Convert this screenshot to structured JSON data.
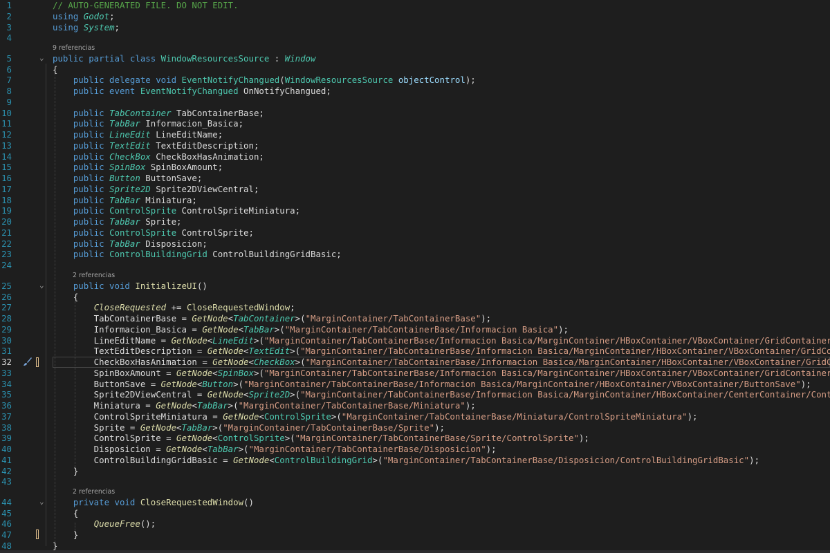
{
  "editor": {
    "current_line": 32,
    "lines": [
      {
        "n": 1,
        "t": [
          [
            "cm",
            "// AUTO-GENERATED FILE. DO NOT EDIT."
          ]
        ]
      },
      {
        "n": 2,
        "t": [
          [
            "kw",
            "using "
          ],
          [
            "ty",
            "Godot"
          ],
          [
            "ev",
            ";"
          ]
        ]
      },
      {
        "n": 3,
        "t": [
          [
            "kw",
            "using "
          ],
          [
            "ty",
            "System"
          ],
          [
            "ev",
            ";"
          ]
        ]
      },
      {
        "n": 4,
        "t": []
      },
      {
        "n": 5,
        "lens": "9 referencias",
        "t": [
          [
            "kw",
            "public partial class "
          ],
          [
            "cl",
            "WindowResourcesSource"
          ],
          [
            "ev",
            " : "
          ],
          [
            "ty",
            "Window"
          ]
        ]
      },
      {
        "n": 6,
        "t": [
          [
            "ev",
            "{"
          ]
        ]
      },
      {
        "n": 7,
        "t": [
          [
            "kw",
            "    public delegate void "
          ],
          [
            "cl",
            "EventNotifyChangued"
          ],
          [
            "ev",
            "("
          ],
          [
            "cl",
            "WindowResourcesSource"
          ],
          [
            "ev",
            " "
          ],
          [
            "prm",
            "objectControl"
          ],
          [
            "ev",
            ");"
          ]
        ]
      },
      {
        "n": 8,
        "t": [
          [
            "kw",
            "    public event "
          ],
          [
            "cl",
            "EventNotifyChangued"
          ],
          [
            "ev",
            " OnNotifyChangued;"
          ]
        ]
      },
      {
        "n": 9,
        "t": []
      },
      {
        "n": 10,
        "t": [
          [
            "kw",
            "    public "
          ],
          [
            "ty",
            "TabContainer"
          ],
          [
            "ev",
            " TabContainerBase;"
          ]
        ]
      },
      {
        "n": 11,
        "t": [
          [
            "kw",
            "    public "
          ],
          [
            "ty",
            "TabBar"
          ],
          [
            "ev",
            " Informacion_Basica;"
          ]
        ]
      },
      {
        "n": 12,
        "t": [
          [
            "kw",
            "    public "
          ],
          [
            "ty",
            "LineEdit"
          ],
          [
            "ev",
            " LineEditName;"
          ]
        ]
      },
      {
        "n": 13,
        "t": [
          [
            "kw",
            "    public "
          ],
          [
            "ty",
            "TextEdit"
          ],
          [
            "ev",
            " TextEditDescription;"
          ]
        ]
      },
      {
        "n": 14,
        "t": [
          [
            "kw",
            "    public "
          ],
          [
            "ty",
            "CheckBox"
          ],
          [
            "ev",
            " CheckBoxHasAnimation;"
          ]
        ]
      },
      {
        "n": 15,
        "t": [
          [
            "kw",
            "    public "
          ],
          [
            "ty",
            "SpinBox"
          ],
          [
            "ev",
            " SpinBoxAmount;"
          ]
        ]
      },
      {
        "n": 16,
        "t": [
          [
            "kw",
            "    public "
          ],
          [
            "ty",
            "Button"
          ],
          [
            "ev",
            " ButtonSave;"
          ]
        ]
      },
      {
        "n": 17,
        "t": [
          [
            "kw",
            "    public "
          ],
          [
            "ty",
            "Sprite2D"
          ],
          [
            "ev",
            " Sprite2DViewCentral;"
          ]
        ]
      },
      {
        "n": 18,
        "t": [
          [
            "kw",
            "    public "
          ],
          [
            "ty",
            "TabBar"
          ],
          [
            "ev",
            " Miniatura;"
          ]
        ]
      },
      {
        "n": 19,
        "t": [
          [
            "kw",
            "    public "
          ],
          [
            "cl",
            "ControlSprite"
          ],
          [
            "ev",
            " ControlSpriteMiniatura;"
          ]
        ]
      },
      {
        "n": 20,
        "t": [
          [
            "kw",
            "    public "
          ],
          [
            "ty",
            "TabBar"
          ],
          [
            "ev",
            " Sprite;"
          ]
        ]
      },
      {
        "n": 21,
        "t": [
          [
            "kw",
            "    public "
          ],
          [
            "cl",
            "ControlSprite"
          ],
          [
            "ev",
            " ControlSprite;"
          ]
        ]
      },
      {
        "n": 22,
        "t": [
          [
            "kw",
            "    public "
          ],
          [
            "ty",
            "TabBar"
          ],
          [
            "ev",
            " Disposicion;"
          ]
        ]
      },
      {
        "n": 23,
        "t": [
          [
            "kw",
            "    public "
          ],
          [
            "cl",
            "ControlBuildingGrid"
          ],
          [
            "ev",
            " ControlBuildingGridBasic;"
          ]
        ]
      },
      {
        "n": 24,
        "t": []
      },
      {
        "n": 25,
        "lens": "2 referencias",
        "t": [
          [
            "kw",
            "    public void "
          ],
          [
            "mth",
            "InitializeUI"
          ],
          [
            "ev",
            "()"
          ]
        ]
      },
      {
        "n": 26,
        "t": [
          [
            "ev",
            "    {"
          ]
        ]
      },
      {
        "n": 27,
        "t": [
          [
            "ev",
            "        "
          ],
          [
            "evi",
            "CloseRequested"
          ],
          [
            "ev",
            " += "
          ],
          [
            "mth",
            "CloseRequestedWindow"
          ],
          [
            "ev",
            ";"
          ]
        ]
      },
      {
        "n": 28,
        "t": [
          [
            "ev",
            "        TabContainerBase = "
          ],
          [
            "mthi",
            "GetNode"
          ],
          [
            "ev",
            "<"
          ],
          [
            "ty",
            "TabContainer"
          ],
          [
            "ev",
            ">("
          ],
          [
            "str",
            "\"MarginContainer/TabContainerBase\""
          ],
          [
            "ev",
            ");"
          ]
        ]
      },
      {
        "n": 29,
        "t": [
          [
            "ev",
            "        Informacion_Basica = "
          ],
          [
            "mthi",
            "GetNode"
          ],
          [
            "ev",
            "<"
          ],
          [
            "ty",
            "TabBar"
          ],
          [
            "ev",
            ">("
          ],
          [
            "str",
            "\"MarginContainer/TabContainerBase/Informacion Basica\""
          ],
          [
            "ev",
            ");"
          ]
        ]
      },
      {
        "n": 30,
        "t": [
          [
            "ev",
            "        LineEditName = "
          ],
          [
            "mthi",
            "GetNode"
          ],
          [
            "ev",
            "<"
          ],
          [
            "ty",
            "LineEdit"
          ],
          [
            "ev",
            ">("
          ],
          [
            "str",
            "\"MarginContainer/TabContainerBase/Informacion Basica/MarginContainer/HBoxContainer/VBoxContainer/GridContainer/LineEd"
          ]
        ]
      },
      {
        "n": 31,
        "t": [
          [
            "ev",
            "        TextEditDescription = "
          ],
          [
            "mthi",
            "GetNode"
          ],
          [
            "ev",
            "<"
          ],
          [
            "ty",
            "TextEdit"
          ],
          [
            "ev",
            ">("
          ],
          [
            "str",
            "\"MarginContainer/TabContainerBase/Informacion Basica/MarginContainer/HBoxContainer/VBoxContainer/GridContainer"
          ]
        ]
      },
      {
        "n": 32,
        "t": [
          [
            "ev",
            "        CheckBoxHasAnimation = "
          ],
          [
            "mthi",
            "GetNode"
          ],
          [
            "ev",
            "<"
          ],
          [
            "ty",
            "CheckBox"
          ],
          [
            "ev",
            ">("
          ],
          [
            "str",
            "\"MarginContainer/TabContainerBase/Informacion Basica/MarginContainer/HBoxContainer/VBoxContainer/GridContaine"
          ]
        ]
      },
      {
        "n": 33,
        "t": [
          [
            "ev",
            "        SpinBoxAmount = "
          ],
          [
            "mthi",
            "GetNode"
          ],
          [
            "ev",
            "<"
          ],
          [
            "ty",
            "SpinBox"
          ],
          [
            "ev",
            ">("
          ],
          [
            "str",
            "\"MarginContainer/TabContainerBase/Informacion Basica/MarginContainer/HBoxContainer/VBoxContainer/GridContainer/SpinBo"
          ]
        ]
      },
      {
        "n": 34,
        "t": [
          [
            "ev",
            "        ButtonSave = "
          ],
          [
            "mthi",
            "GetNode"
          ],
          [
            "ev",
            "<"
          ],
          [
            "ty",
            "Button"
          ],
          [
            "ev",
            ">("
          ],
          [
            "str",
            "\"MarginContainer/TabContainerBase/Informacion Basica/MarginContainer/HBoxContainer/VBoxContainer/ButtonSave\""
          ],
          [
            "ev",
            ");"
          ]
        ]
      },
      {
        "n": 35,
        "t": [
          [
            "ev",
            "        Sprite2DViewCentral = "
          ],
          [
            "mthi",
            "GetNode"
          ],
          [
            "ev",
            "<"
          ],
          [
            "ty",
            "Sprite2D"
          ],
          [
            "ev",
            ">("
          ],
          [
            "str",
            "\"MarginContainer/TabContainerBase/Informacion Basica/MarginContainer/HBoxContainer/CenterContainer/Control/Spr"
          ]
        ]
      },
      {
        "n": 36,
        "t": [
          [
            "ev",
            "        Miniatura = "
          ],
          [
            "mthi",
            "GetNode"
          ],
          [
            "ev",
            "<"
          ],
          [
            "ty",
            "TabBar"
          ],
          [
            "ev",
            ">("
          ],
          [
            "str",
            "\"MarginContainer/TabContainerBase/Miniatura\""
          ],
          [
            "ev",
            ");"
          ]
        ]
      },
      {
        "n": 37,
        "t": [
          [
            "ev",
            "        ControlSpriteMiniatura = "
          ],
          [
            "mthi",
            "GetNode"
          ],
          [
            "ev",
            "<"
          ],
          [
            "cl",
            "ControlSprite"
          ],
          [
            "ev",
            ">("
          ],
          [
            "str",
            "\"MarginContainer/TabContainerBase/Miniatura/ControlSpriteMiniatura\""
          ],
          [
            "ev",
            ");"
          ]
        ]
      },
      {
        "n": 38,
        "t": [
          [
            "ev",
            "        Sprite = "
          ],
          [
            "mthi",
            "GetNode"
          ],
          [
            "ev",
            "<"
          ],
          [
            "ty",
            "TabBar"
          ],
          [
            "ev",
            ">("
          ],
          [
            "str",
            "\"MarginContainer/TabContainerBase/Sprite\""
          ],
          [
            "ev",
            ");"
          ]
        ]
      },
      {
        "n": 39,
        "t": [
          [
            "ev",
            "        ControlSprite = "
          ],
          [
            "mthi",
            "GetNode"
          ],
          [
            "ev",
            "<"
          ],
          [
            "cl",
            "ControlSprite"
          ],
          [
            "ev",
            ">("
          ],
          [
            "str",
            "\"MarginContainer/TabContainerBase/Sprite/ControlSprite\""
          ],
          [
            "ev",
            ");"
          ]
        ]
      },
      {
        "n": 40,
        "t": [
          [
            "ev",
            "        Disposicion = "
          ],
          [
            "mthi",
            "GetNode"
          ],
          [
            "ev",
            "<"
          ],
          [
            "ty",
            "TabBar"
          ],
          [
            "ev",
            ">("
          ],
          [
            "str",
            "\"MarginContainer/TabContainerBase/Disposicion\""
          ],
          [
            "ev",
            ");"
          ]
        ]
      },
      {
        "n": 41,
        "t": [
          [
            "ev",
            "        ControlBuildingGridBasic = "
          ],
          [
            "mthi",
            "GetNode"
          ],
          [
            "ev",
            "<"
          ],
          [
            "cl",
            "ControlBuildingGrid"
          ],
          [
            "ev",
            ">("
          ],
          [
            "str",
            "\"MarginContainer/TabContainerBase/Disposicion/ControlBuildingGridBasic\""
          ],
          [
            "ev",
            ");"
          ]
        ]
      },
      {
        "n": 42,
        "t": [
          [
            "ev",
            "    }"
          ]
        ]
      },
      {
        "n": 43,
        "t": []
      },
      {
        "n": 44,
        "lens": "2 referencias",
        "t": [
          [
            "kw",
            "    private void "
          ],
          [
            "mth",
            "CloseRequestedWindow"
          ],
          [
            "ev",
            "()"
          ]
        ]
      },
      {
        "n": 45,
        "t": [
          [
            "ev",
            "    {"
          ]
        ]
      },
      {
        "n": 46,
        "t": [
          [
            "ev",
            "        "
          ],
          [
            "mthi",
            "QueueFree"
          ],
          [
            "ev",
            "();"
          ]
        ]
      },
      {
        "n": 47,
        "t": [
          [
            "ev",
            "    }"
          ]
        ]
      },
      {
        "n": 48,
        "t": [
          [
            "ev",
            "}"
          ]
        ]
      }
    ]
  },
  "icons": {
    "fold": "chevron-down-icon",
    "brush": "brush-icon"
  }
}
